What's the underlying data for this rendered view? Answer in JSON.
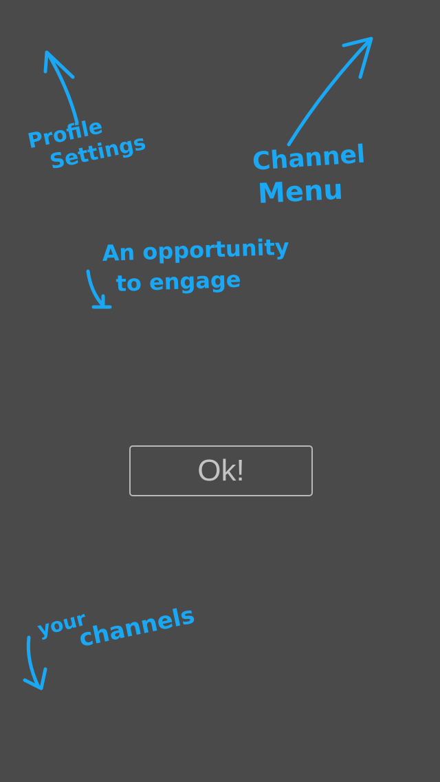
{
  "annotations": {
    "profile_settings": {
      "line1": "Profile",
      "line2": "Settings"
    },
    "channel_menu": {
      "line1": "Channel",
      "line2": "Menu"
    },
    "engage": {
      "line1": "An opportunity",
      "line2": "to engage"
    },
    "your_channels": {
      "line1": "your",
      "line2": "channels"
    }
  },
  "dialog": {
    "ok_label": "Ok!"
  },
  "colors": {
    "background": "#4a4a4a",
    "annotation": "#1aa7f4",
    "button_border": "#b8b8b8",
    "button_text": "#c4c4c4"
  }
}
